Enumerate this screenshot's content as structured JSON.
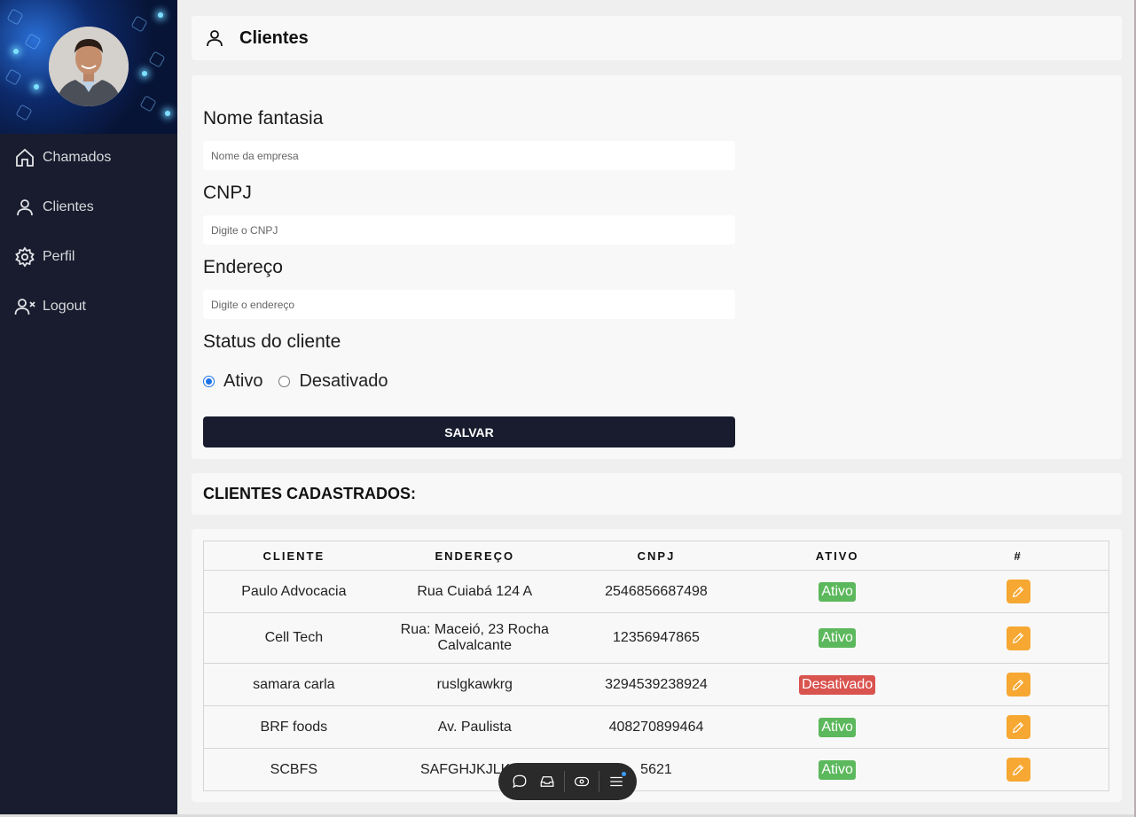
{
  "sidebar": {
    "avatar_alt": "user-avatar",
    "items": [
      {
        "label": "Chamados",
        "icon": "home-icon"
      },
      {
        "label": "Clientes",
        "icon": "user-icon"
      },
      {
        "label": "Perfil",
        "icon": "gear-icon"
      },
      {
        "label": "Logout",
        "icon": "user-x-icon"
      }
    ]
  },
  "header": {
    "title": "Clientes",
    "icon": "user-icon"
  },
  "form": {
    "name_label": "Nome fantasia",
    "name_placeholder": "Nome da empresa",
    "cnpj_label": "CNPJ",
    "cnpj_placeholder": "Digite o CNPJ",
    "address_label": "Endereço",
    "address_placeholder": "Digite o endereço",
    "status_label": "Status do cliente",
    "status_options": [
      {
        "label": "Ativo",
        "checked": true
      },
      {
        "label": "Desativado",
        "checked": false
      }
    ],
    "save_label": "SALVAR"
  },
  "list": {
    "title": "CLIENTES CADASTRADOS:",
    "columns": [
      "CLIENTE",
      "ENDEREÇO",
      "CNPJ",
      "ATIVO",
      "#"
    ],
    "rows": [
      {
        "cliente": "Paulo Advocacia",
        "endereco": "Rua Cuiabá 124 A",
        "cnpj": "2546856687498",
        "ativo": "Ativo"
      },
      {
        "cliente": "Cell Tech",
        "endereco": "Rua: Maceió, 23 Rocha Calvalcante",
        "cnpj": "12356947865",
        "ativo": "Ativo"
      },
      {
        "cliente": "samara carla",
        "endereco": "ruslgkawkrg",
        "cnpj": "3294539238924",
        "ativo": "Desativado"
      },
      {
        "cliente": "BRF foods",
        "endereco": "Av. Paulista",
        "cnpj": "408270899464",
        "ativo": "Ativo"
      },
      {
        "cliente": "SCBFS",
        "endereco": "SAFGHJKJLKHF",
        "cnpj": "5621",
        "ativo": "Ativo"
      }
    ]
  },
  "floating_toolbar": {
    "icons": [
      "chat-icon",
      "inbox-icon",
      "eye-icon",
      "menu-icon"
    ]
  },
  "colors": {
    "sidebar_bg": "#181c2e",
    "active_badge": "#5cb85c",
    "inactive_badge": "#d9534f",
    "edit_button": "#f6a833"
  }
}
